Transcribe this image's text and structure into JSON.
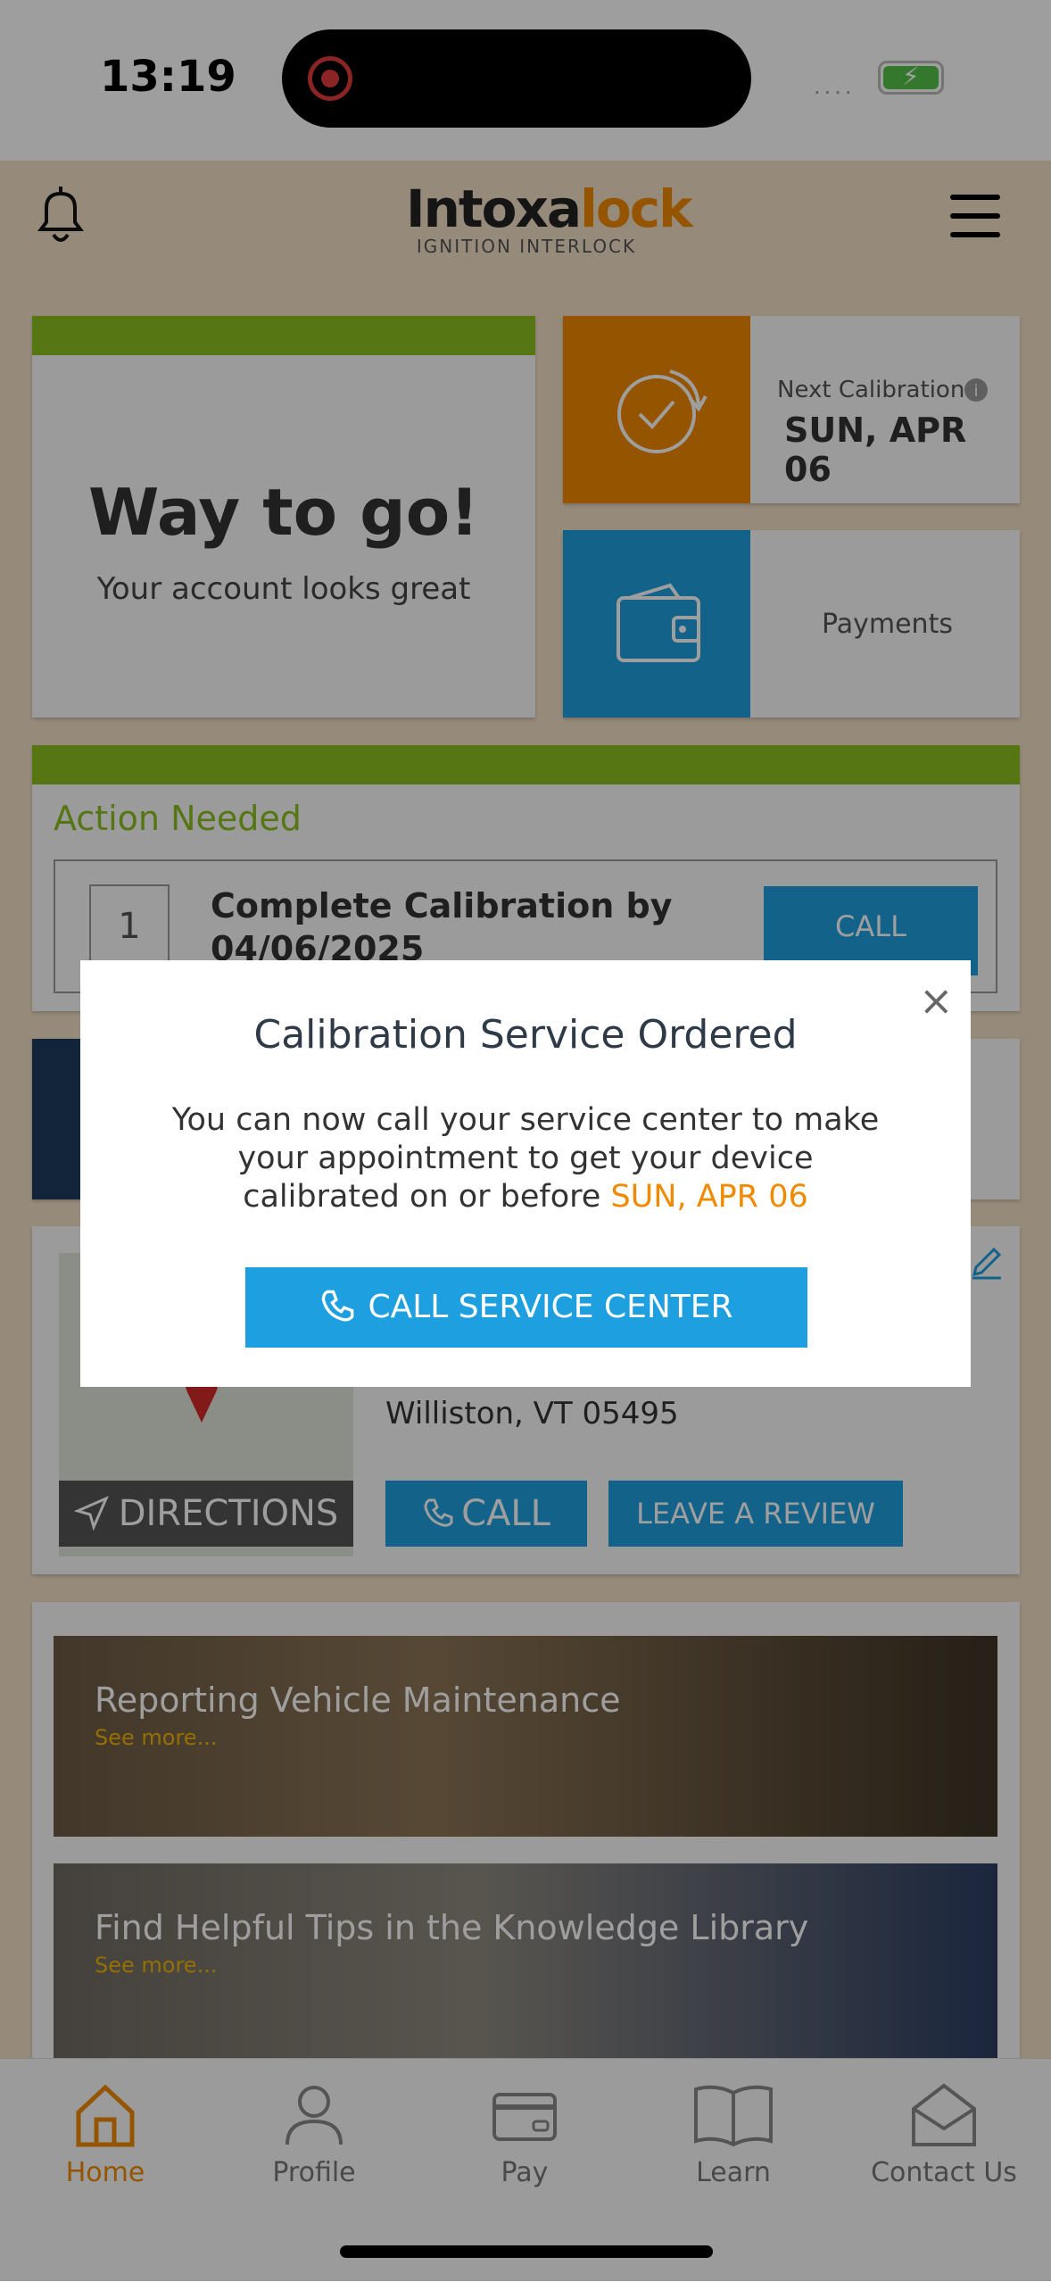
{
  "status_bar": {
    "time": "13:19",
    "signal": "····"
  },
  "header": {
    "logo_main": "Intoxa",
    "logo_accent": "lock",
    "logo_sub": "IGNITION INTERLOCK"
  },
  "account": {
    "headline": "Way to go!",
    "subtext": "Your account looks great"
  },
  "calibration": {
    "label": "Next Calibration",
    "date": "SUN, APR 06"
  },
  "payments": {
    "label": "Payments"
  },
  "action": {
    "title": "Action Needed",
    "item_number": "1",
    "item_text_line1": "Complete Calibration by",
    "item_text_line2": "04/06/2025",
    "call_label": "CALL"
  },
  "service_center": {
    "address_line2": "Williston, VT 05495",
    "directions_label": "DIRECTIONS",
    "call_label": "CALL",
    "review_label": "LEAVE A REVIEW"
  },
  "news": [
    {
      "title": "Reporting Vehicle Maintenance",
      "link": "See more..."
    },
    {
      "title": "Find Helpful Tips in the Knowledge Library",
      "link": "See more..."
    }
  ],
  "tabs": [
    {
      "label": "Home",
      "active": true
    },
    {
      "label": "Profile"
    },
    {
      "label": "Pay"
    },
    {
      "label": "Learn"
    },
    {
      "label": "Contact Us"
    }
  ],
  "modal": {
    "close": "×",
    "title": "Calibration Service Ordered",
    "body": "You can now call your service center to make your appointment to get your device calibrated on or before ",
    "date": "SUN, APR 06",
    "button_label": "CALL SERVICE CENTER"
  },
  "colors": {
    "accent": "#f08a00",
    "blue": "#1e9fdf",
    "green": "#8bbf1f"
  }
}
